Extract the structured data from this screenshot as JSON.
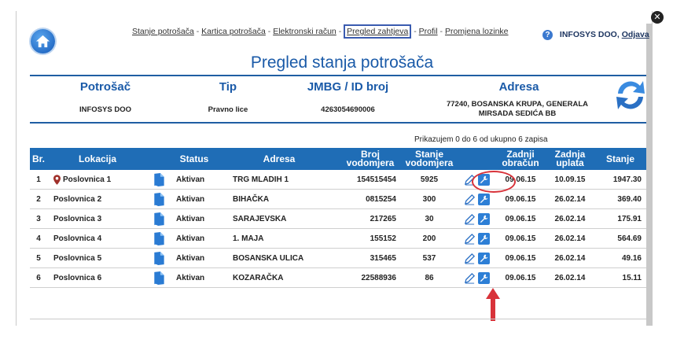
{
  "nav": {
    "items": [
      "Stanje potrošača",
      "Kartica potrošača",
      "Elektronski račun",
      "Pregled zahtjeva",
      "Profil",
      "Promjena lozinke"
    ],
    "active_index": 3
  },
  "user": {
    "company": "INFOSYS DOO,",
    "logout": "Odjava"
  },
  "title": "Pregled stanja potrošača",
  "info": {
    "headers": {
      "consumer": "Potrošač",
      "type": "Tip",
      "jmbg": "JMBG / ID broj",
      "address": "Adresa"
    },
    "values": {
      "consumer": "INFOSYS DOO",
      "type": "Pravno lice",
      "jmbg": "4263054690006",
      "address": "77240, BOSANSKA KRUPA, GENERALA MIRSADA SEDIĆA BB"
    }
  },
  "count_info": "Prikazujem 0 do 6 od ukupno 6 zapisa",
  "table": {
    "headers": {
      "br": "Br.",
      "location": "Lokacija",
      "status": "Status",
      "address": "Adresa",
      "meter_no": "Broj vodomjera",
      "meter_state": "Stanje vodomjera",
      "last_bill": "Zadnji obračun",
      "last_payment": "Zadnja uplata",
      "balance": "Stanje"
    },
    "rows": [
      {
        "br": "1",
        "location": "Poslovnica 1",
        "status": "Aktivan",
        "address": "TRG MLADIH 1",
        "meter_no": "154515454",
        "meter_state": "5925",
        "last_bill": "09.06.15",
        "last_payment": "10.09.15",
        "balance": "1947.30"
      },
      {
        "br": "2",
        "location": "Poslovnica 2",
        "status": "Aktivan",
        "address": "BIHAČKA",
        "meter_no": "0815254",
        "meter_state": "300",
        "last_bill": "09.06.15",
        "last_payment": "26.02.14",
        "balance": "369.40"
      },
      {
        "br": "3",
        "location": "Poslovnica 3",
        "status": "Aktivan",
        "address": "SARAJEVSKA",
        "meter_no": "217265",
        "meter_state": "30",
        "last_bill": "09.06.15",
        "last_payment": "26.02.14",
        "balance": "175.91"
      },
      {
        "br": "4",
        "location": "Poslovnica 4",
        "status": "Aktivan",
        "address": "1. MAJA",
        "meter_no": "155152",
        "meter_state": "200",
        "last_bill": "09.06.15",
        "last_payment": "26.02.14",
        "balance": "564.69"
      },
      {
        "br": "5",
        "location": "Poslovnica 5",
        "status": "Aktivan",
        "address": "BOSANSKA ULICA",
        "meter_no": "315465",
        "meter_state": "537",
        "last_bill": "09.06.15",
        "last_payment": "26.02.14",
        "balance": "49.16"
      },
      {
        "br": "6",
        "location": "Poslovnica 6",
        "status": "Aktivan",
        "address": "KOZARAČKA",
        "meter_no": "22588936",
        "meter_state": "86",
        "last_bill": "09.06.15",
        "last_payment": "26.02.14",
        "balance": "15.11"
      }
    ]
  },
  "colors": {
    "accent": "#1f6db6",
    "title": "#1a5aa8",
    "highlight": "#d8333a",
    "pin": "#a0302a"
  },
  "icons": {
    "home": "home-icon",
    "help": "help-icon",
    "refresh": "refresh-icon",
    "pin": "location-pin-icon",
    "doc": "document-icon",
    "edit": "pencil-icon",
    "settings": "wrench-icon",
    "close": "close-icon"
  }
}
